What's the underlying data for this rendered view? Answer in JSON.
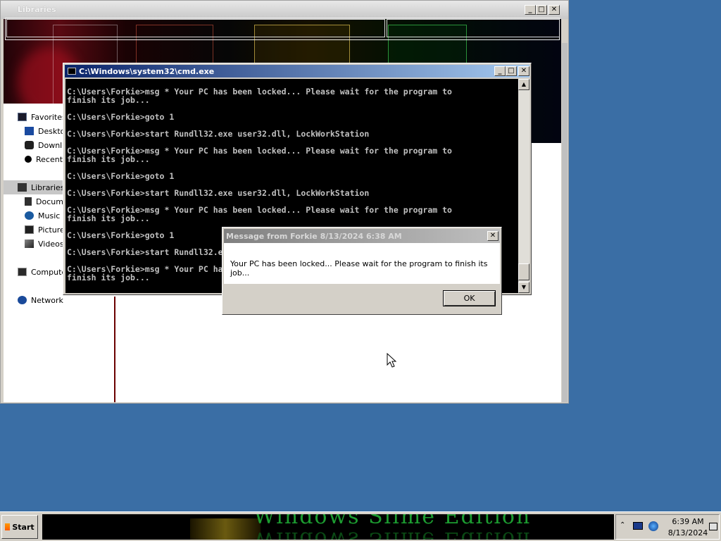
{
  "explorer": {
    "title": "Libraries",
    "nav": {
      "favorites": "Favorites",
      "desktop": "Deskto",
      "downloads": "Downlo",
      "recent": "Recent",
      "libraries": "Libraries",
      "documents": "Docum",
      "music": "Music",
      "pictures": "Picture",
      "videos": "Videos",
      "computer": "Compute",
      "network": "Network"
    }
  },
  "cmd": {
    "title": "C:\\Windows\\system32\\cmd.exe",
    "lines": "C:\\Users\\Forkie>msg * Your PC has been locked... Please wait for the program to\nfinish its job...\n\nC:\\Users\\Forkie>goto 1\n\nC:\\Users\\Forkie>start Rundll32.exe user32.dll, LockWorkStation\n\nC:\\Users\\Forkie>msg * Your PC has been locked... Please wait for the program to\nfinish its job...\n\nC:\\Users\\Forkie>goto 1\n\nC:\\Users\\Forkie>start Rundll32.exe user32.dll, LockWorkStation\n\nC:\\Users\\Forkie>msg * Your PC has been locked... Please wait for the program to\nfinish its job...\n\nC:\\Users\\Forkie>goto 1\n\nC:\\Users\\Forkie>start Rundll32.exe user32.dll, LockWorkStation\n\nC:\\Users\\Forkie>msg * Your PC has been locked... Please wait for the program to\nfinish its job..."
  },
  "dialog": {
    "title": "Message from Forkie 8/13/2024 6:38 AM",
    "message": "Your PC has been locked... Please wait for the program to finish its job...",
    "ok_label": "OK"
  },
  "taskbar": {
    "start_label": "Start",
    "brand": "Windows Slime Edition",
    "clock_time": "6:39 AM",
    "clock_date": "8/13/2024"
  },
  "icons": {
    "close": "close-icon",
    "maximize": "maximize-icon",
    "minimize": "minimize-icon",
    "scroll_up": "scroll-up-icon",
    "scroll_down": "scroll-down-icon",
    "show_hidden": "chevron-up-icon",
    "monitor": "monitor-icon",
    "volume": "volume-icon",
    "action_center": "action-center-icon"
  },
  "colors": {
    "desktop": "#3a6ea5",
    "title_active": "#0a246a",
    "title_inactive": "#808080",
    "console_bg": "#000000",
    "console_text": "#c0c0c0",
    "brand_green": "#1c9c30"
  }
}
